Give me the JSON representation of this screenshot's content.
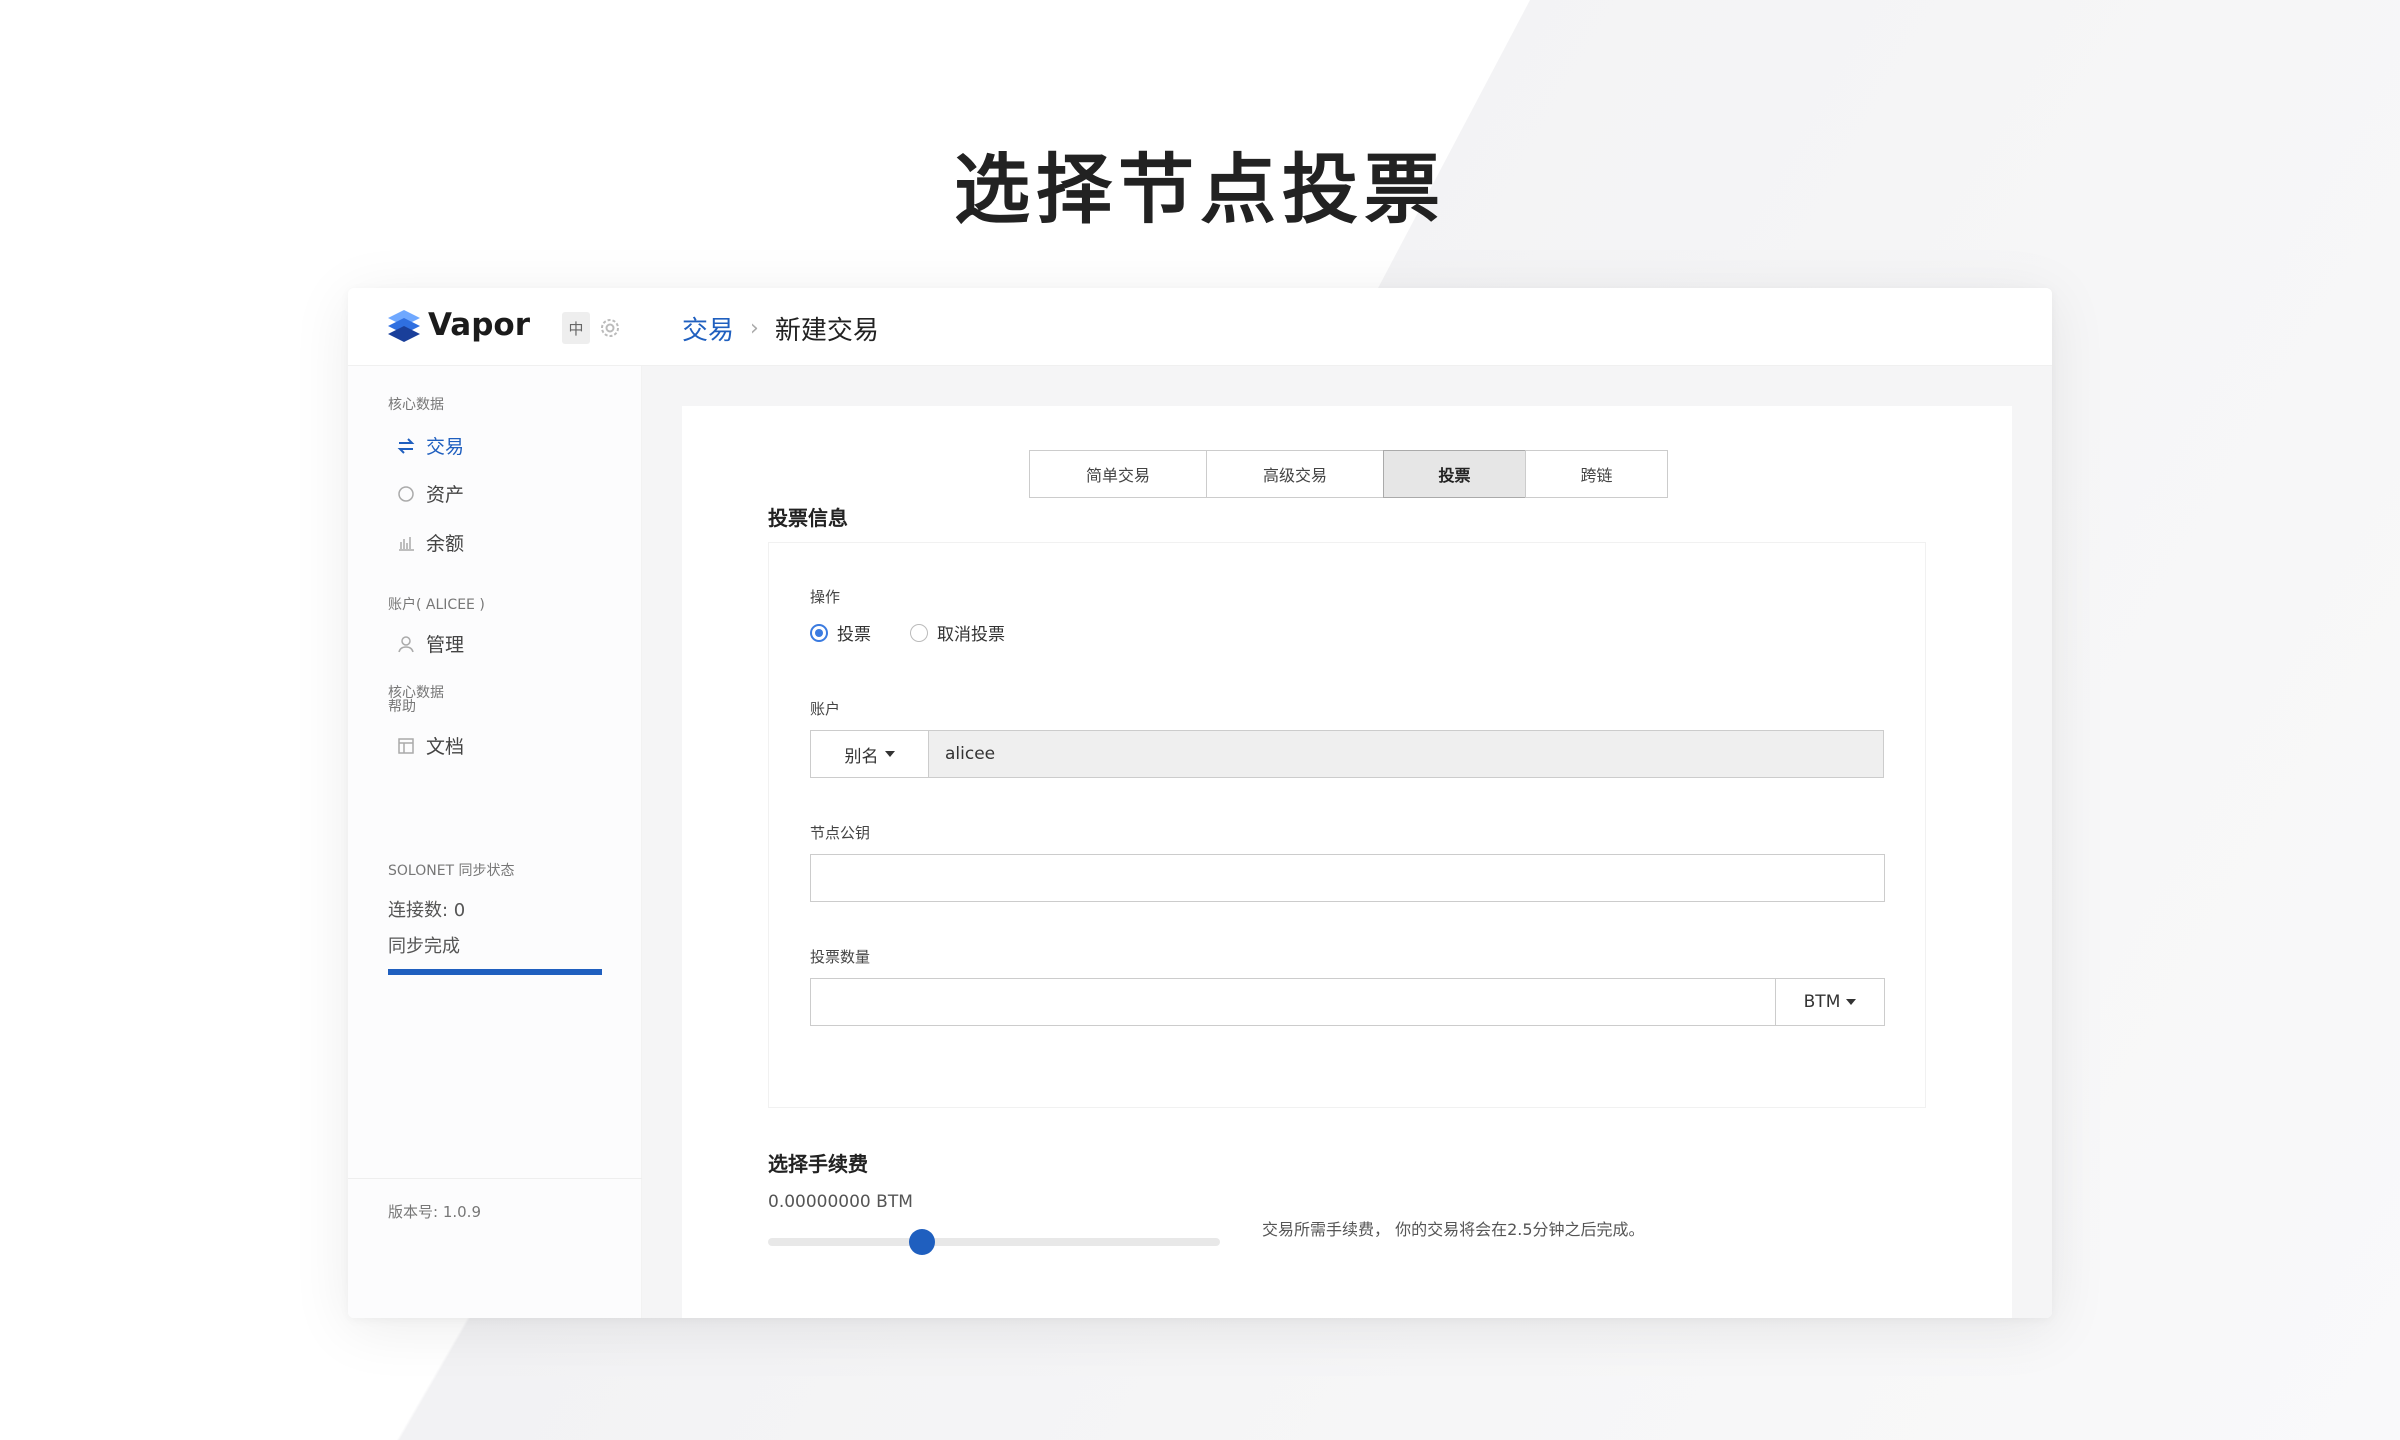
{
  "headline": "选择节点投票",
  "app": {
    "name": "Vapor",
    "lang": "中"
  },
  "breadcrumb": {
    "parent": "交易",
    "separator": "›",
    "current": "新建交易"
  },
  "sidebar": {
    "core_section": "核心数据",
    "core_items": [
      {
        "label": "交易",
        "icon": "transfer-icon",
        "active": true
      },
      {
        "label": "资产",
        "icon": "circle-icon"
      },
      {
        "label": "余额",
        "icon": "bar-chart-icon"
      }
    ],
    "account_section": "账户( ALICEE )",
    "account_items": [
      {
        "label": "管理",
        "icon": "user-icon"
      }
    ],
    "help_section": "帮助",
    "help_items": [
      {
        "label": "文档",
        "icon": "document-icon"
      }
    ],
    "sync_title": "SOLONET 同步状态",
    "connections": "连接数: 0",
    "sync_status": "同步完成",
    "sync_progress": 1.0,
    "version": "版本号: 1.0.9"
  },
  "tabs": [
    {
      "label": "简单交易"
    },
    {
      "label": "高级交易"
    },
    {
      "label": "投票",
      "active": true
    },
    {
      "label": "跨链"
    }
  ],
  "vote": {
    "title": "投票信息",
    "op_label": "操作",
    "op_vote": "投票",
    "op_cancel": "取消投票",
    "op_selected": "投票",
    "account_label": "账户",
    "account_addon": "别名",
    "account_value": "alicee",
    "pubkey_label": "节点公钥",
    "pubkey_value": "",
    "amount_label": "投票数量",
    "amount_value": "",
    "amount_unit": "BTM"
  },
  "fee": {
    "title": "选择手续费",
    "value": "0.00000000 BTM",
    "slider_level": 0.34,
    "note": "交易所需手续费， 你的交易将会在2.5分钟之后完成。"
  },
  "colors": {
    "accent": "#1f5fbf",
    "radio": "#3b7be0"
  }
}
